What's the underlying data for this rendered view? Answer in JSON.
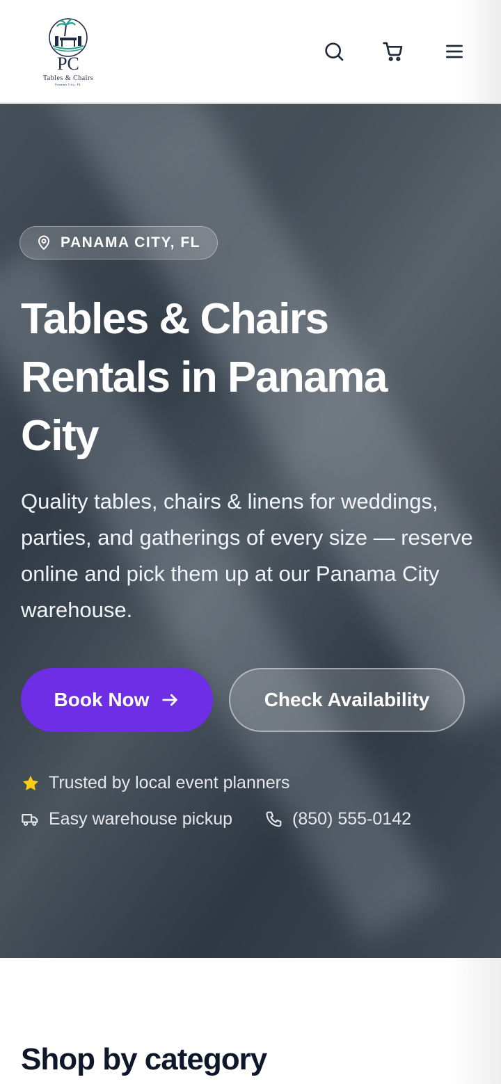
{
  "header": {
    "logo": {
      "monogram": "PC",
      "name": "Tables & Chairs",
      "location": "Panama City, FL"
    },
    "icons": [
      "search-icon",
      "cart-icon",
      "menu-icon"
    ]
  },
  "hero": {
    "location_badge": "PANAMA CITY, FL",
    "title": "Tables & Chairs Rentals in Panama City",
    "subtitle": "Quality tables, chairs & linens for weddings, parties, and gatherings of every size — reserve online and pick them up at our Panama City warehouse.",
    "primary_button": "Book Now",
    "secondary_button": "Check Availability",
    "trust": {
      "planners": "Trusted by local event planners",
      "pickup": "Easy warehouse pickup",
      "phone": "(850) 555-0142"
    }
  },
  "section": {
    "shop_title": "Shop by category"
  },
  "colors": {
    "accent": "#6d2ee6",
    "star": "#facc15",
    "logo_navy": "#1f2a44",
    "logo_teal": "#2a9d8f"
  }
}
